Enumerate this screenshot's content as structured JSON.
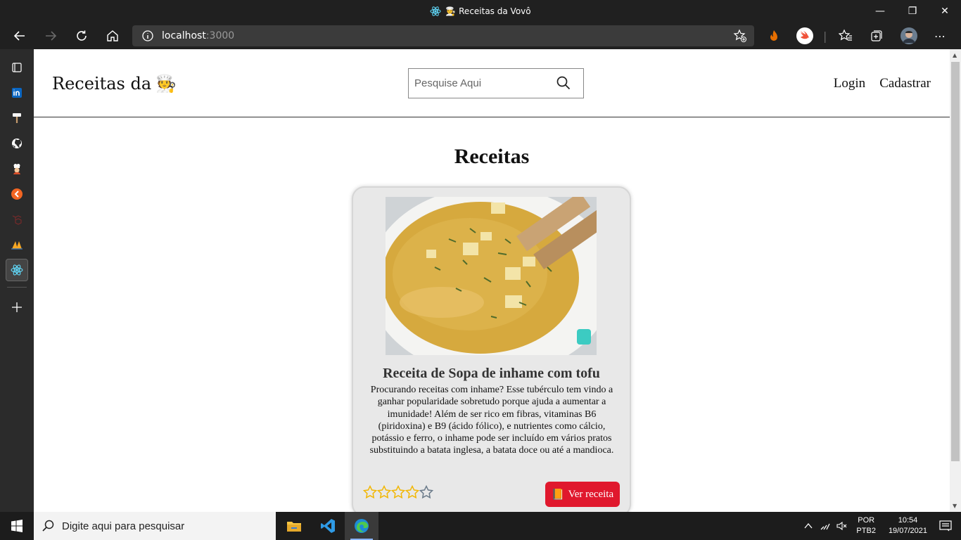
{
  "window": {
    "title": "🧑‍🍳 Receitas da Vovô",
    "controls": [
      "minimize-icon",
      "restore-icon",
      "close-icon"
    ]
  },
  "toolbar": {
    "url_host": "localhost",
    "url_port": ":3000"
  },
  "sidebar": {
    "items": [
      "tabs-icon",
      "linkedin-icon",
      "paint-roller-icon",
      "github-icon",
      "chef-icon",
      "app-orange-icon",
      "laravel-icon",
      "app-sail-icon",
      "react-icon"
    ],
    "add_icon": "plus-icon"
  },
  "page": {
    "brand": "Receitas da",
    "brand_emoji": "🧑‍🍳",
    "search_placeholder": "Pesquise Aqui",
    "nav": {
      "login": "Login",
      "signup": "Cadastrar"
    },
    "heading": "Receitas"
  },
  "card": {
    "title": "Receita de Sopa de inhame com tofu",
    "description": "Procurando receitas com inhame? Esse tubérculo tem vindo a ganhar popularidade sobretudo porque ajuda a aumentar a imunidade! Além de ser rico em fibras, vitaminas B6 (piridoxina) e B9 (ácido fólico), e nutrientes como cálcio, potássio e ferro, o inhame pode ser incluído em vários pratos substituindo a batata inglesa, a batata doce ou até a mandioca.",
    "rating": 4,
    "rating_max": 5,
    "button_label": "Ver receita",
    "button_emoji": "📙"
  },
  "taskbar": {
    "search_placeholder": "Digite aqui para pesquisar",
    "lang_top": "POR",
    "lang_bottom": "PTB2",
    "time": "10:54",
    "date": "19/07/2021"
  },
  "colors": {
    "accent_button": "#e0182d",
    "star": "#f2b705"
  }
}
